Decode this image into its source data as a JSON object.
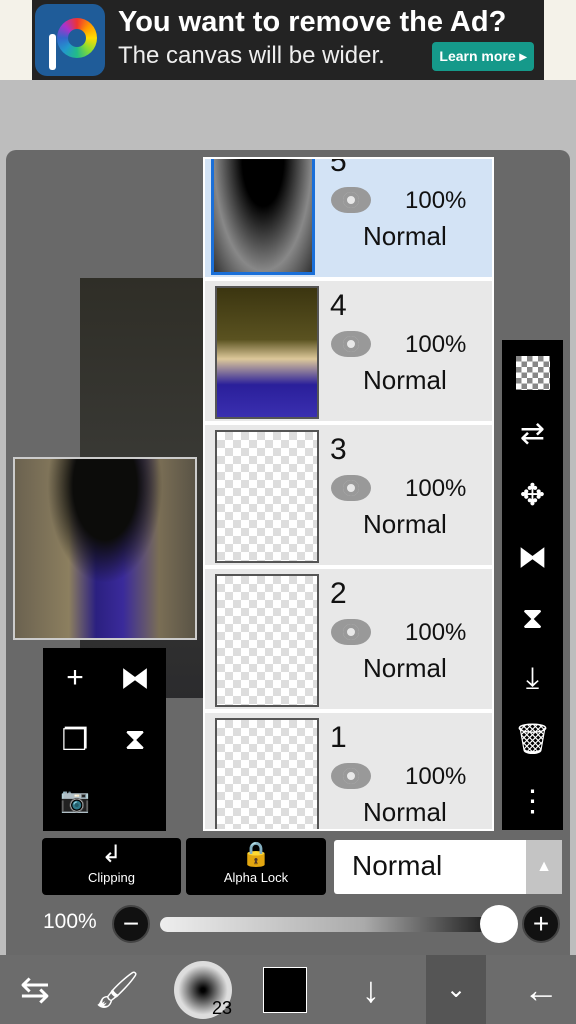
{
  "ad": {
    "title": "You want to remove the Ad?",
    "subtitle": "The canvas will be wider.",
    "button": "Learn more ▸"
  },
  "layers": [
    {
      "number": "5",
      "opacity": "100%",
      "mode": "Normal",
      "selected": true
    },
    {
      "number": "4",
      "opacity": "100%",
      "mode": "Normal",
      "selected": false
    },
    {
      "number": "3",
      "opacity": "100%",
      "mode": "Normal",
      "selected": false
    },
    {
      "number": "2",
      "opacity": "100%",
      "mode": "Normal",
      "selected": false
    },
    {
      "number": "1",
      "opacity": "100%",
      "mode": "Normal",
      "selected": false
    }
  ],
  "controls": {
    "clipping": "Clipping",
    "alpha_lock": "Alpha Lock",
    "blend_mode": "Normal",
    "opacity": "100%",
    "opacity_value": 100
  },
  "toolbar": {
    "brush_size": "23",
    "color": "#000000"
  },
  "colors": {
    "selected_row": "#d3e3f5",
    "selected_border": "#1a6fd8",
    "ad_button": "#15998a"
  }
}
